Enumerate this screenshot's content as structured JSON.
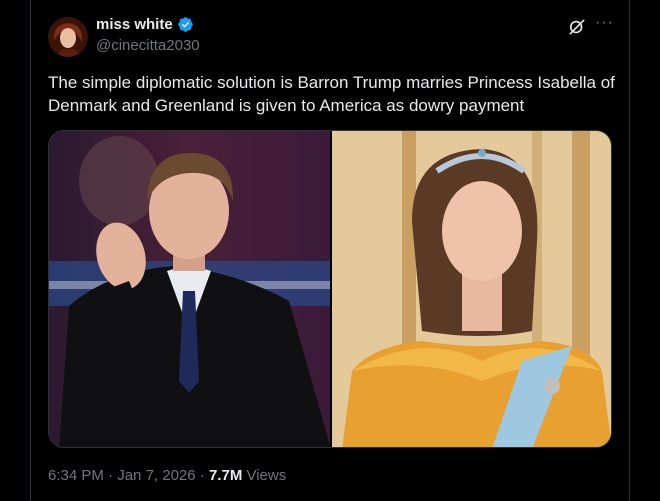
{
  "author": {
    "name": "miss white",
    "handle": "@cinecitta2030",
    "verified_color": "#1d9bf0"
  },
  "post": {
    "text": "The simple diplomatic solution is Barron Trump marries Princess Isabella of Denmark and Greenland is given to America as dowry payment"
  },
  "meta": {
    "time": "6:34 PM",
    "separator": " · ",
    "date": "Jan 7, 2026",
    "views_count": "7.7M",
    "views_label": " Views"
  },
  "icons": {
    "grok": "grok-icon",
    "more": "more-icon",
    "verified": "verified-badge-icon"
  }
}
